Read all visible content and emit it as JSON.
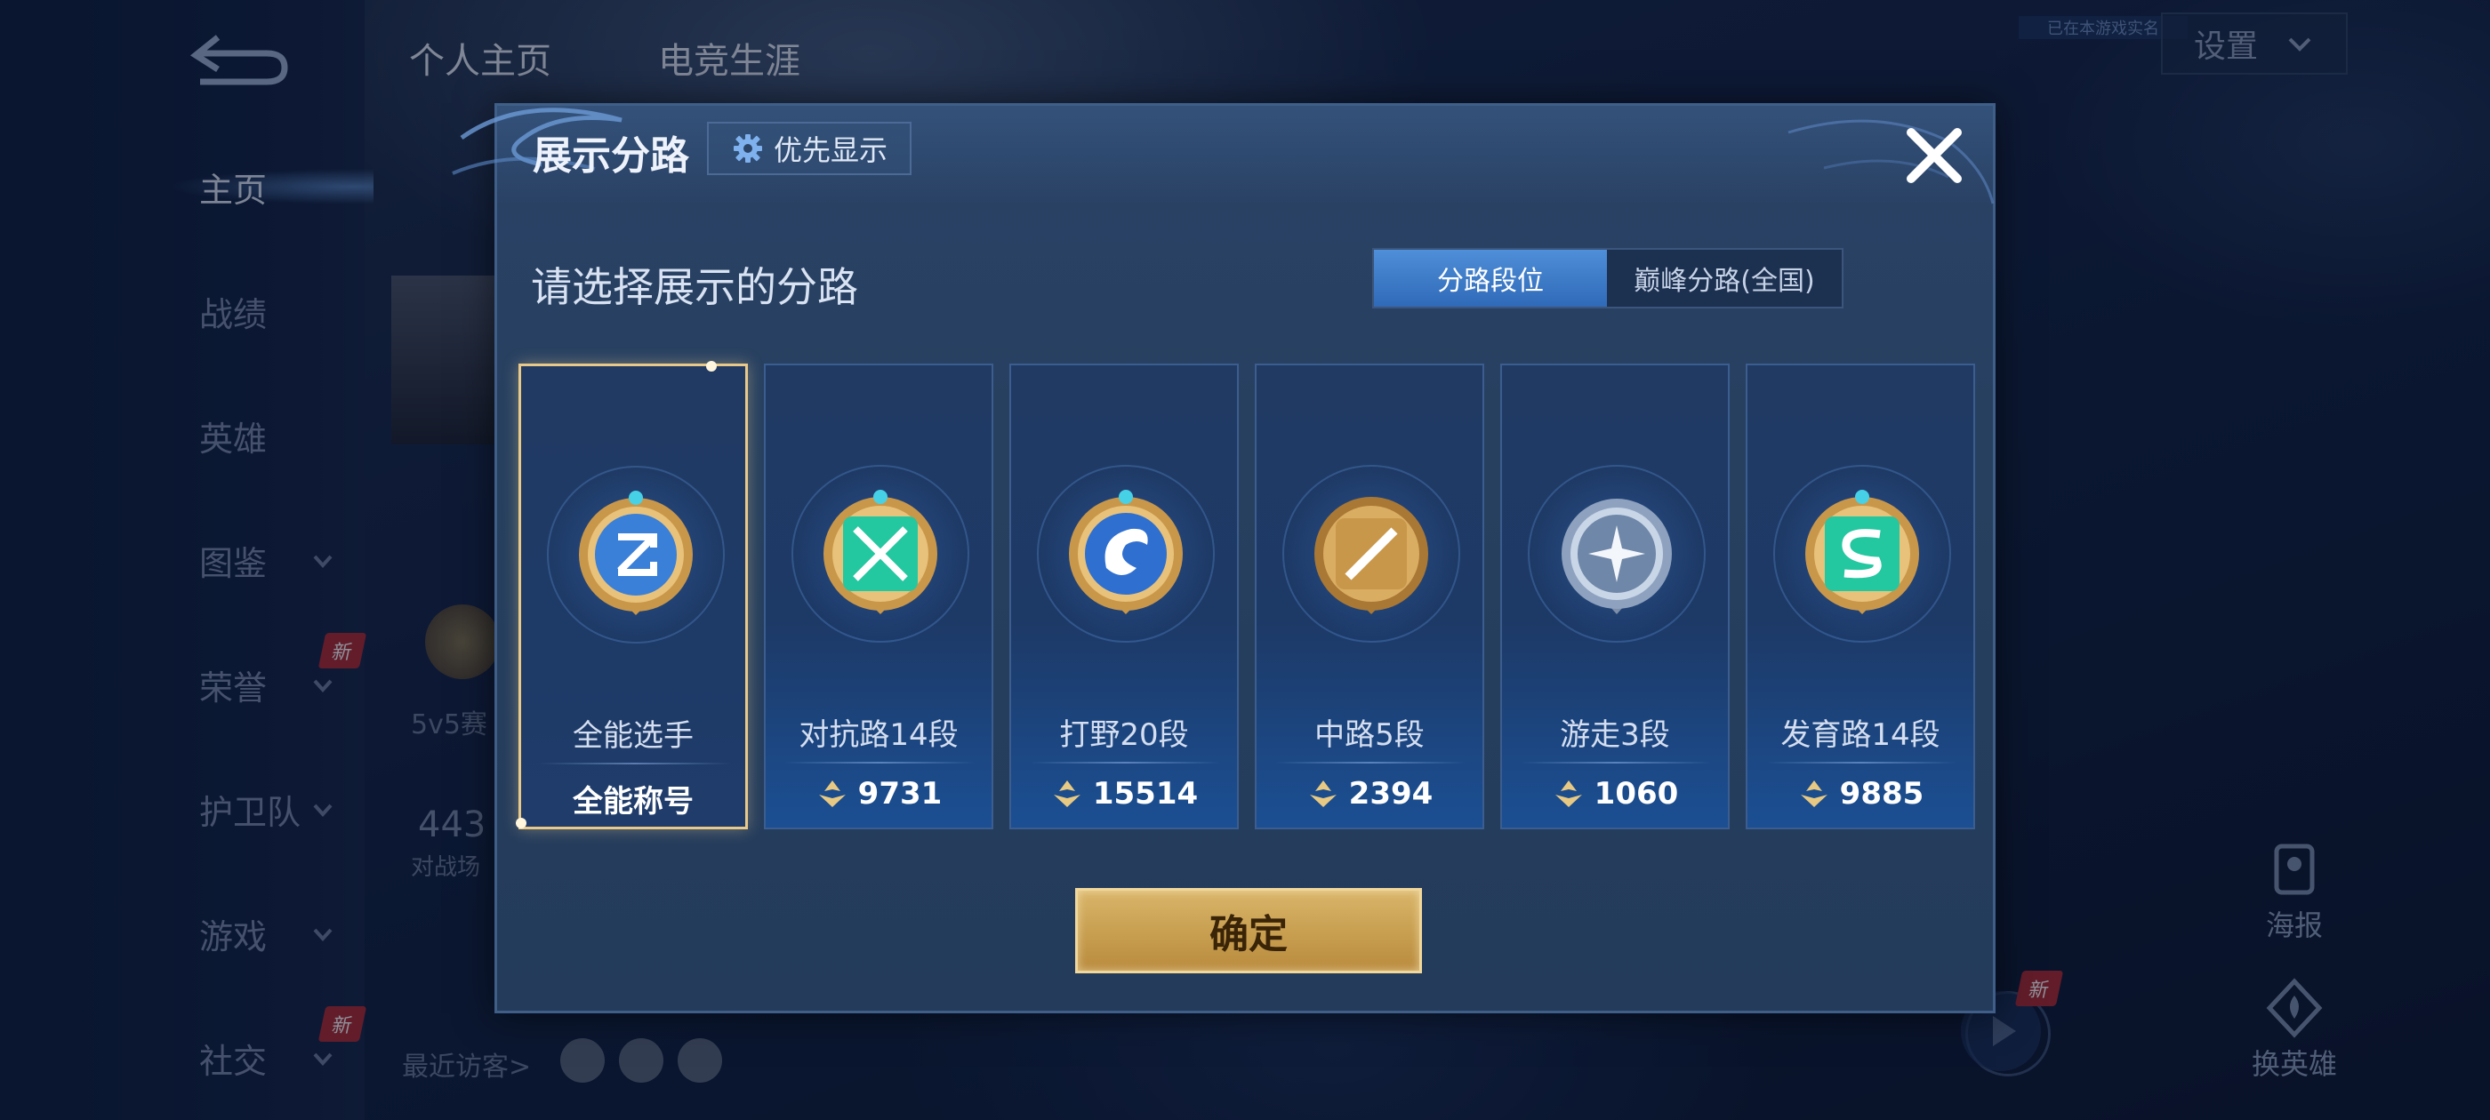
{
  "background": {
    "back_icon": "back-arrow-icon",
    "nav": [
      {
        "label": "主页",
        "active": true,
        "chevron": false,
        "badge": ""
      },
      {
        "label": "战绩",
        "active": false,
        "chevron": false,
        "badge": ""
      },
      {
        "label": "英雄",
        "active": false,
        "chevron": false,
        "badge": ""
      },
      {
        "label": "图鉴",
        "active": false,
        "chevron": true,
        "badge": ""
      },
      {
        "label": "荣誉",
        "active": false,
        "chevron": true,
        "badge": "新"
      },
      {
        "label": "护卫队",
        "active": false,
        "chevron": true,
        "badge": ""
      },
      {
        "label": "游戏",
        "active": false,
        "chevron": true,
        "badge": ""
      },
      {
        "label": "社交",
        "active": false,
        "chevron": true,
        "badge": "新"
      }
    ],
    "tabs": [
      "个人主页",
      "电竞生涯"
    ],
    "partial_texts": {
      "mode": "5v5赛",
      "count": "443",
      "count_label": "对战场",
      "visitors": "最近访客>"
    },
    "top_notice": "已在本游戏实名",
    "settings_label": "设置",
    "right_tools": [
      {
        "label": "海报",
        "icon": "poster-icon"
      },
      {
        "label": "换英雄",
        "icon": "swap-hero-icon"
      }
    ],
    "right_badge": "新"
  },
  "modal": {
    "title": "展示分路",
    "priority_button": "优先显示",
    "priority_icon": "gear-icon",
    "close_icon": "close-icon",
    "subtitle": "请选择展示的分路",
    "toggle": {
      "options": [
        "分路段位",
        "巅峰分路(全国)"
      ],
      "selected": 0
    },
    "cards": [
      {
        "name": "全能选手",
        "value": "全能称号",
        "selected": true,
        "emblem": "allround-emblem-icon",
        "color": "#3a7fd8"
      },
      {
        "name": "对抗路14段",
        "value": "9731",
        "selected": false,
        "emblem": "clash-lane-emblem-icon",
        "color": "#23c7a0"
      },
      {
        "name": "打野20段",
        "value": "15514",
        "selected": false,
        "emblem": "jungle-emblem-icon",
        "color": "#2f6fd0"
      },
      {
        "name": "中路5段",
        "value": "2394",
        "selected": false,
        "emblem": "mid-lane-emblem-icon",
        "color": "#c9974a"
      },
      {
        "name": "游走3段",
        "value": "1060",
        "selected": false,
        "emblem": "roam-emblem-icon",
        "color": "#9fb2cc"
      },
      {
        "name": "发育路14段",
        "value": "9885",
        "selected": false,
        "emblem": "farm-lane-emblem-icon",
        "color": "#23c7a0"
      }
    ],
    "points_icon": "points-icon",
    "confirm_label": "确定"
  }
}
